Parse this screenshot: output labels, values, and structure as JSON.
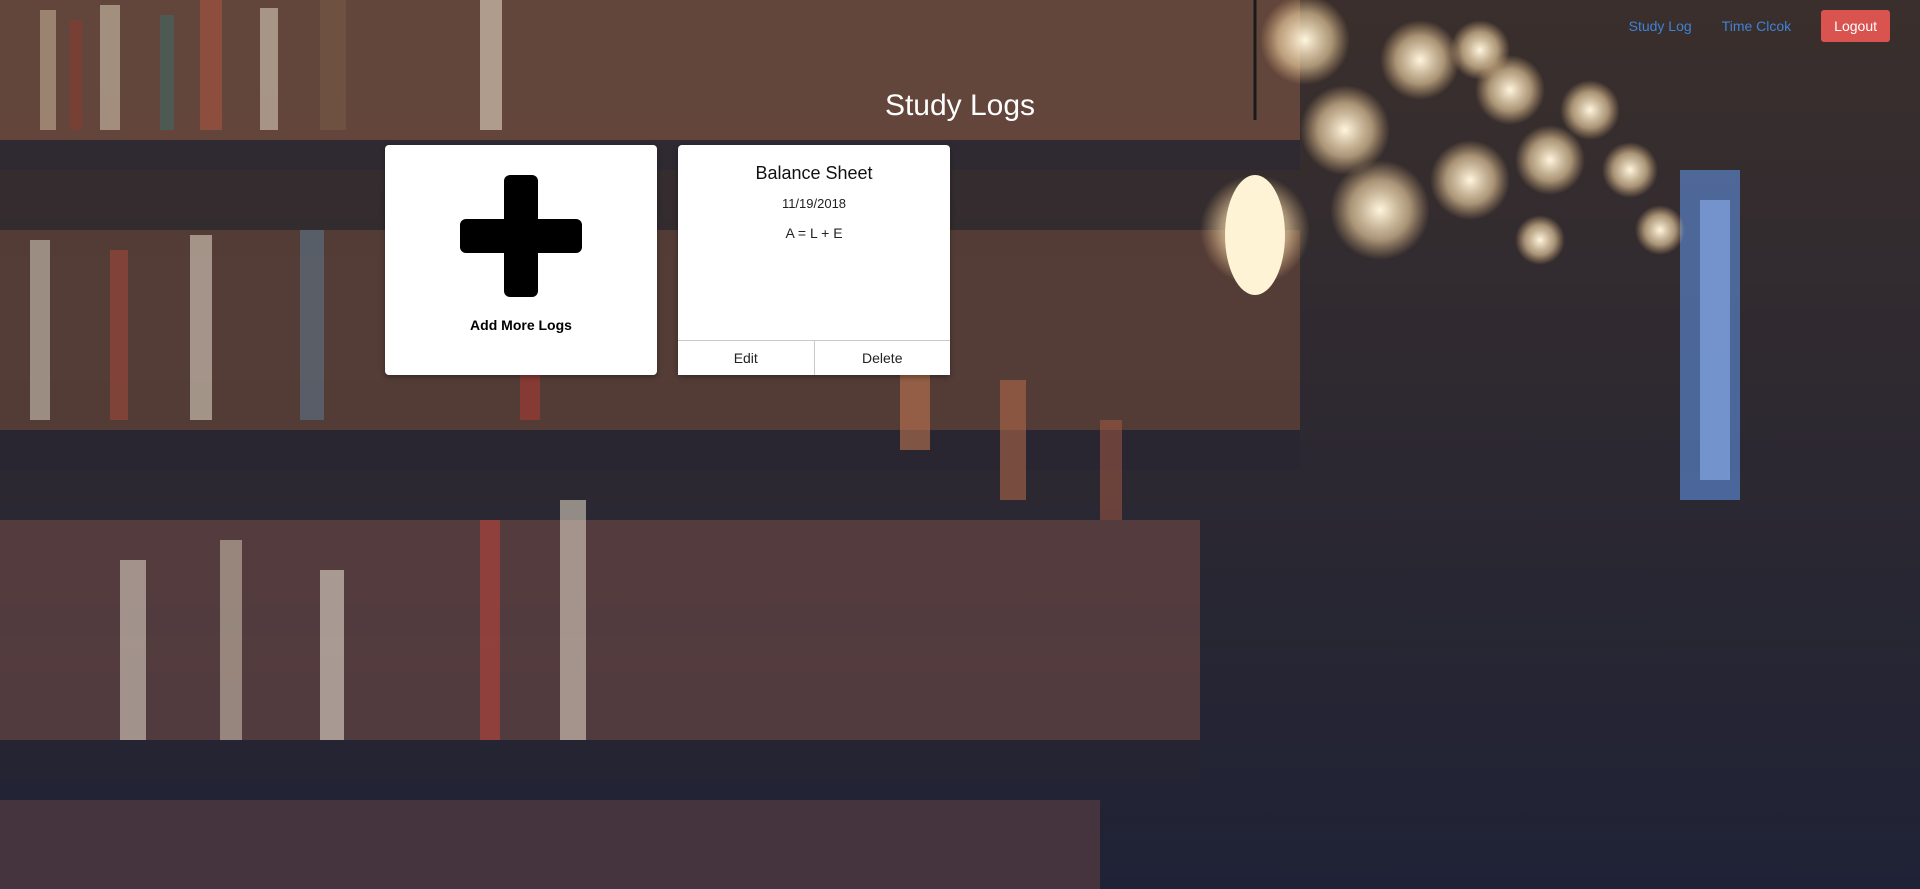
{
  "nav": {
    "study_log": "Study Log",
    "time_clock": "Time Clcok",
    "logout": "Logout"
  },
  "page": {
    "title": "Study Logs"
  },
  "add_card": {
    "label": "Add More Logs",
    "icon": "plus-icon"
  },
  "logs": [
    {
      "title": "Balance Sheet",
      "date": "11/19/2018",
      "body": "A = L + E",
      "edit_label": "Edit",
      "delete_label": "Delete"
    }
  ],
  "colors": {
    "link": "#3f82d6",
    "logout": "#d9534f",
    "background": "#2a2c40"
  }
}
